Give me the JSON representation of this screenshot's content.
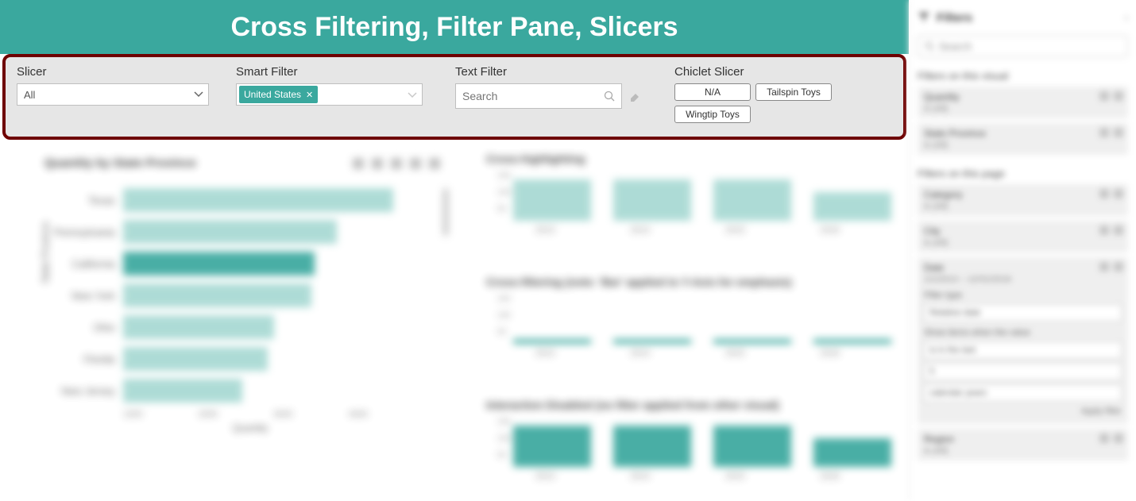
{
  "banner": {
    "title": "Cross Filtering, Filter Pane, Slicers"
  },
  "slicers": {
    "slicer": {
      "label": "Slicer",
      "value": "All"
    },
    "smart": {
      "label": "Smart Filter",
      "chip": "United States"
    },
    "text": {
      "label": "Text Filter",
      "placeholder": "Search"
    },
    "chiclet": {
      "label": "Chiclet Slicer",
      "items": [
        "N/A",
        "Tailspin Toys",
        "Wingtip Toys"
      ]
    }
  },
  "chart_data": [
    {
      "type": "bar",
      "orientation": "horizontal",
      "title": "Quantity by State Province",
      "xlabel": "Quantity",
      "ylabel": "State Province",
      "categories": [
        "Texas",
        "Pennsylvania",
        "California",
        "New York",
        "Ohio",
        "Florida",
        "New Jersey"
      ],
      "values": [
        4300,
        3400,
        3050,
        3000,
        2400,
        2300,
        1900
      ],
      "highlighted_category": "California",
      "x_ticks": [
        1000,
        2000,
        3000,
        4000
      ],
      "truncated": true
    },
    {
      "type": "bar",
      "title": "Cross-highlighting",
      "categories": [
        "2013",
        "2014",
        "2015",
        "2016"
      ],
      "values": [
        130,
        130,
        130,
        90
      ],
      "ylim": [
        0,
        150
      ],
      "y_ticks": [
        50,
        100,
        150
      ]
    },
    {
      "type": "bar",
      "title": "Cross-filtering (note: 'Bar' applied to Y-Axis for emphasis)",
      "categories": [
        "2013",
        "2014",
        "2015",
        "2016"
      ],
      "values": [
        8,
        8,
        8,
        6
      ],
      "ylim": [
        0,
        150
      ],
      "y_ticks": [
        50,
        100,
        150
      ]
    },
    {
      "type": "bar",
      "title": "Interaction Disabled (no filter applied from other visual)",
      "categories": [
        "2013",
        "2014",
        "2015",
        "2016"
      ],
      "values": [
        130,
        130,
        130,
        90
      ],
      "ylim": [
        0,
        150
      ],
      "y_ticks": [
        50,
        100,
        150
      ]
    }
  ],
  "filter_pane": {
    "title": "Filters",
    "search_placeholder": "Search",
    "sections": [
      {
        "title": "Filters on this visual",
        "cards": [
          {
            "name": "Quantity",
            "summary": "is (All)"
          },
          {
            "name": "State Province",
            "summary": "is (All)"
          }
        ]
      },
      {
        "title": "Filters on this page",
        "cards": [
          {
            "name": "Category",
            "summary": "is (All)"
          },
          {
            "name": "City",
            "summary": "is (All)"
          },
          {
            "name": "Date",
            "summary": "1/1/2013 – 12/31/2016",
            "expanded": true,
            "filter_type_label": "Filter type",
            "filter_type_value": "Relative date",
            "show_items_label": "Show items when the value",
            "op": "is in the last",
            "num": "5",
            "unit": "calendar years",
            "apply": "Apply filter"
          },
          {
            "name": "Region",
            "summary": "is (All)"
          }
        ]
      }
    ]
  }
}
